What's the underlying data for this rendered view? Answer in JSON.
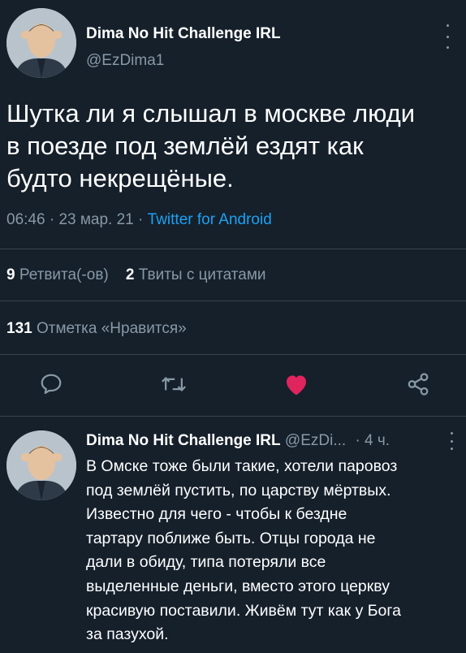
{
  "tweet": {
    "author_name": "Dima No Hit Challenge IRL",
    "handle": "@EzDima1",
    "text_lines": [
      "Шутка ли я слышал в москве люди",
      "в поезде под землёй ездят как",
      "будто некрещёные."
    ],
    "time": "06:46",
    "date": "23 мар. 21",
    "source": "Twitter for Android",
    "retweets_count": "9",
    "retweets_label": "Ретвита(-ов)",
    "quotes_count": "2",
    "quotes_label": "Твиты с цитатами",
    "likes_count": "131",
    "likes_label": "Отметка «Нравится»"
  },
  "actions": {
    "reply_icon": "speech-bubble-icon",
    "retweet_icon": "retweet-icon",
    "like_icon": "heart-icon",
    "like_color": "#e0245e",
    "share_icon": "share-icon"
  },
  "reply": {
    "author_name": "Dima No Hit Challenge IRL",
    "handle": "@EzDi...",
    "time": "· 4 ч.",
    "text_lines": [
      "В Омске тоже были такие, хотели паровоз",
      "под землёй пустить, по царству мёртвых.",
      "Известно для чего - чтобы к бездне",
      "тартару поближе быть. Отцы города не",
      "дали в обиду, типа потеряли все",
      "выделенные деньги, вместо этого церкву",
      "красивую поставили. Живём тут как у Бога",
      "за пазухой."
    ]
  },
  "colors": {
    "background": "#15202b",
    "muted": "#8899a6",
    "accent": "#1da1f2",
    "divider": "#38444d"
  }
}
